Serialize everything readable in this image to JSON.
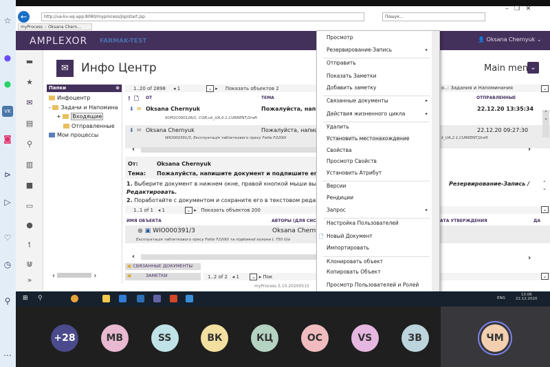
{
  "browser": {
    "url": "http://ua-kv-aq-app:8080/myprocess/jsp/start.jsp",
    "search_placeholder": "Пошук...",
    "tab_title": "myProcess :: Oksana Chern..."
  },
  "app": {
    "logo": "AMPLEXOR",
    "env": "FARMAK-TEST",
    "user": "Oksana Chernyuk",
    "page_title": "Инфо Центр",
    "main_menu": "Main menu"
  },
  "folders": {
    "header": "Папки",
    "items": [
      "Инфоцентр",
      "Задачи и Напомина",
      "Входящие",
      "Отправленные",
      "Мои процессы"
    ]
  },
  "list": {
    "pager": "1..20 of 2898",
    "page": "1",
    "show_label": "Показать объектов",
    "show_value": "2",
    "filter_label": "о..:",
    "filter_value": "Задания и Напоминания",
    "columns": [
      "ОТ",
      "ТЕМА",
      "ОТПРАВЛЕННЫЕ"
    ],
    "rows": [
      {
        "from": "Oksana Chernyuk",
        "subject": "Пожалуйста, напиш",
        "sent": "22.12.20 13:35:34",
        "doc": "SOPQC000126/1, COR,uk_UA,0.1,CURRENT,Draft"
      },
      {
        "from": "Oksana Chernyuk",
        "subject": "Пожалуйста, напиш",
        "sent": "22.12.20 09:27:30",
        "doc": "WIO000391/3, Експлуатація таблеткового пресу Fette F2200i",
        "doc_tail": "k_UA,2.1,CURRENT,Draft"
      }
    ]
  },
  "detail": {
    "from_label": "От:",
    "from": "Oksana Chernyuk",
    "subject_label": "Тема:",
    "subject": "Пожалуйста, напишите документ и подпишите его",
    "step1_num": "1.",
    "step1": "Выберите документ в нижнем окне, правой кнопкой мыши выз",
    "step1_tail": "Резервирование-Запись /",
    "step1_b": "Редактировать.",
    "step2_num": "2.",
    "step2": "Поработайте с документом и сохраните его в текстовом редакто"
  },
  "objects": {
    "pager": "1..1 of 1",
    "page": "1",
    "show_label": "Показать объектов",
    "show_value": "200",
    "columns": [
      "ИМЯ ОБЪЕКТА",
      "АВТОРЫ (ДЛЯ СИС",
      "АТА УТВЕРЖДЕНИЯ",
      "ДА"
    ],
    "row": {
      "name": "WIO000391/3",
      "author": "Oksana Chernyu",
      "desc": "Експлуатація таблеткового пресу Fette F2200i та підйомної колони L 750 Gla"
    }
  },
  "bottom": {
    "related": "СВЯЗАННЫЕ ДОКУМЕНТЫ",
    "notes": "ЗАМЕТКИ",
    "pager": "1..2 of 2",
    "page": "1",
    "show_label": "Пок",
    "version": "myProcess 5.10.20200515"
  },
  "context_menu": [
    "Просмотр",
    "Резервирование-Запись",
    "Отправить",
    "Показать Заметки",
    "Добавить заметку",
    "Связанные документы",
    "Действия жизненного цикла",
    "Удалить",
    "Установить местонахождение",
    "Свойства",
    "Просмотр Свойств",
    "Установить Атрибут",
    "Версии",
    "Рендиции",
    "Запрос",
    "Настройка Пользователей",
    "Новый Документ",
    "Импортировать",
    "Клонировать объект",
    "Копировать Объект",
    "Просмотр Пользователей и Ролей"
  ],
  "taskbar": {
    "lang": "ENG",
    "time": "13:06",
    "date": "22.12.2020"
  },
  "call": {
    "participants": [
      {
        "initials": "+28",
        "color": "#4b4a8c"
      },
      {
        "initials": "МВ",
        "color": "#e8b9d0"
      },
      {
        "initials": "SS",
        "color": "#bfe3e6"
      },
      {
        "initials": "ВК",
        "color": "#f3e0a0"
      },
      {
        "initials": "КЦ",
        "color": "#b5d3c3"
      },
      {
        "initials": "ОС",
        "color": "#f1bcc0"
      },
      {
        "initials": "VS",
        "color": "#e6b7e0"
      },
      {
        "initials": "ЗВ",
        "color": "#bcd5dc"
      }
    ],
    "self": {
      "initials": "ЧМ",
      "color": "#f1cfb0"
    }
  }
}
